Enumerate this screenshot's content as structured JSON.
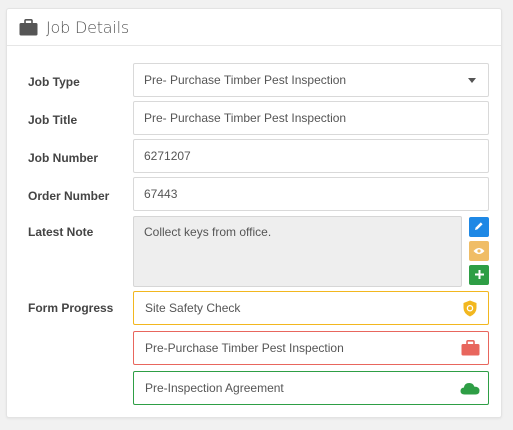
{
  "header": {
    "title": "Job Details",
    "icon": "briefcase-icon"
  },
  "fields": {
    "job_type_label": "Job Type",
    "job_type_value": "Pre- Purchase Timber Pest Inspection",
    "job_title_label": "Job Title",
    "job_title_value": "Pre- Purchase Timber Pest Inspection",
    "job_number_label": "Job Number",
    "job_number_value": "6271207",
    "order_number_label": "Order Number",
    "order_number_value": "67443",
    "latest_note_label": "Latest Note",
    "latest_note_value": "Collect keys from office."
  },
  "note_actions": [
    {
      "icon": "pencil-icon",
      "color": "#1e88e5"
    },
    {
      "icon": "eye-icon",
      "color": "#f0bd66"
    },
    {
      "icon": "plus-icon",
      "color": "#2e9e45"
    }
  ],
  "form_progress": {
    "label": "Form Progress",
    "items": [
      {
        "label": "Site Safety Check",
        "status_color": "#f2b71f",
        "icon": "shield-icon"
      },
      {
        "label": "Pre-Purchase Timber Pest Inspection",
        "status_color": "#e8665d",
        "icon": "briefcase-icon"
      },
      {
        "label": "Pre-Inspection Agreement",
        "status_color": "#2e9e45",
        "icon": "cloud-icon"
      }
    ]
  }
}
